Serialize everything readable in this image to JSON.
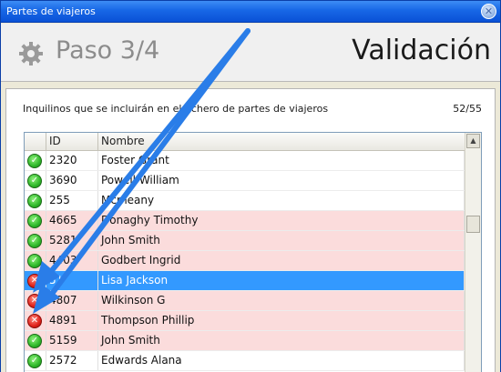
{
  "window": {
    "title": "Partes de viajeros"
  },
  "header": {
    "step": "Paso 3/4",
    "page_title": "Validación"
  },
  "panel": {
    "caption": "Inquilinos que se incluirán en el fichero de partes de viajeros",
    "count": "52/55"
  },
  "grid": {
    "columns": {
      "id": "ID",
      "name": "Nombre"
    },
    "rows": [
      {
        "status": "ok",
        "id": "2320",
        "name": "Foster Grant",
        "state": "normal"
      },
      {
        "status": "ok",
        "id": "3690",
        "name": "Powell William",
        "state": "normal"
      },
      {
        "status": "ok",
        "id": "255",
        "name": "Mcmeany",
        "state": "normal"
      },
      {
        "status": "ok",
        "id": "4665",
        "name": "Donaghy Timothy",
        "state": "warning"
      },
      {
        "status": "ok",
        "id": "5281",
        "name": "John Smith",
        "state": "warning"
      },
      {
        "status": "ok",
        "id": "4403",
        "name": "Godbert Ingrid",
        "state": "warning"
      },
      {
        "status": "error",
        "id": "51",
        "name": "Lisa Jackson",
        "state": "selected"
      },
      {
        "status": "error",
        "id": "4807",
        "name": "Wilkinson G",
        "state": "warning"
      },
      {
        "status": "error",
        "id": "4891",
        "name": "Thompson Phillip",
        "state": "warning"
      },
      {
        "status": "ok",
        "id": "5159",
        "name": "John Smith",
        "state": "warning"
      },
      {
        "status": "ok",
        "id": "2572",
        "name": "Edwards Alana",
        "state": "normal"
      }
    ]
  },
  "icons": {
    "window_close": "close-icon",
    "settings": "gear-icon",
    "ok": "check-icon",
    "error": "x-icon",
    "scroll_up": "up-arrow-icon"
  },
  "colors": {
    "titlebar": "#1767e6",
    "row_warning": "#fbdcdc",
    "row_selected": "#3399ff",
    "annotation_arrow": "#2a7de8"
  }
}
